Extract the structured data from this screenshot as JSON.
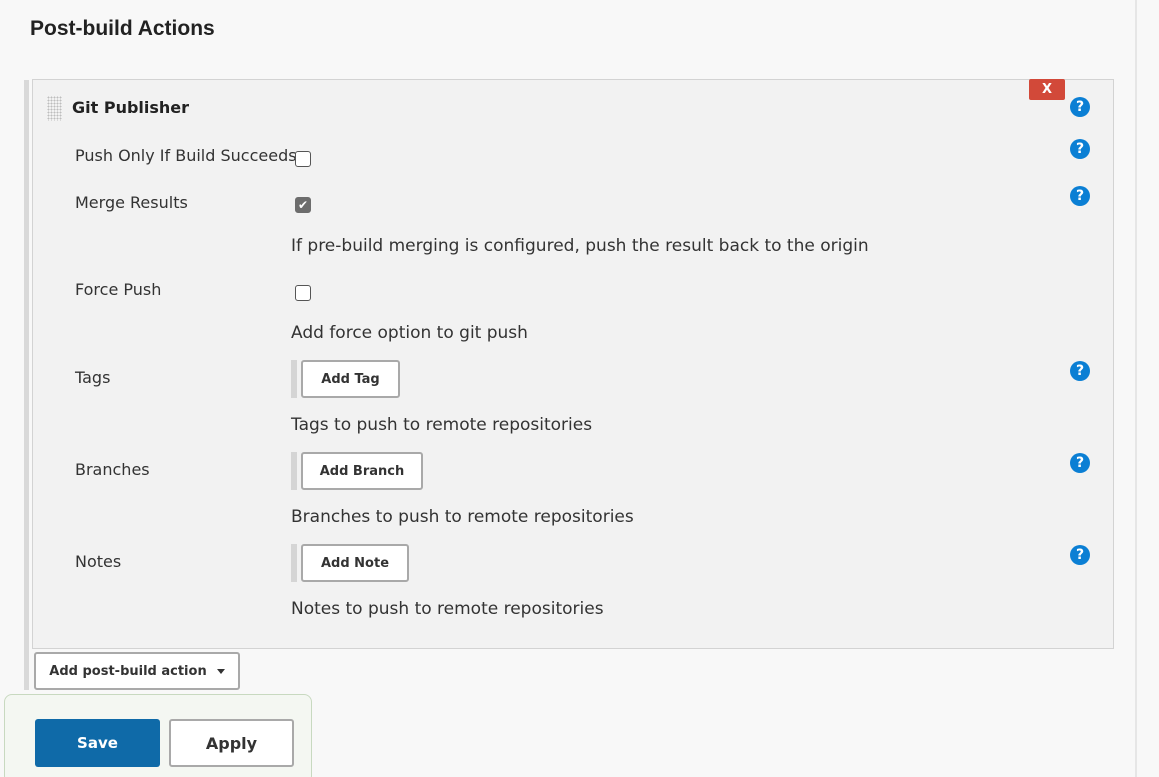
{
  "section": {
    "title": "Post-build Actions"
  },
  "publisher": {
    "title": "Git Publisher",
    "delete_label": "X",
    "help_glyph": "?"
  },
  "fields": {
    "push_only": {
      "label": "Push Only If Build Succeeds",
      "checked": false
    },
    "merge_results": {
      "label": "Merge Results",
      "checked": true,
      "check_glyph": "✔",
      "description": "If pre-build merging is configured, push the result back to the origin"
    },
    "force_push": {
      "label": "Force Push",
      "checked": false,
      "description": "Add force option to git push"
    },
    "tags": {
      "label": "Tags",
      "button": "Add Tag",
      "description": "Tags to push to remote repositories"
    },
    "branches": {
      "label": "Branches",
      "button": "Add Branch",
      "description": "Branches to push to remote repositories"
    },
    "notes": {
      "label": "Notes",
      "button": "Add Note",
      "description": "Notes to push to remote repositories"
    }
  },
  "add_action": {
    "label": "Add post-build action"
  },
  "footer": {
    "save_label": "Save",
    "apply_label": "Apply"
  },
  "colors": {
    "primary": "#0f6aa8",
    "danger": "#d24939",
    "help": "#0b7fd4"
  },
  "icons": {
    "help": "help-icon",
    "delete": "close-icon",
    "drag": "drag-handle-icon",
    "caret": "caret-down-icon"
  }
}
